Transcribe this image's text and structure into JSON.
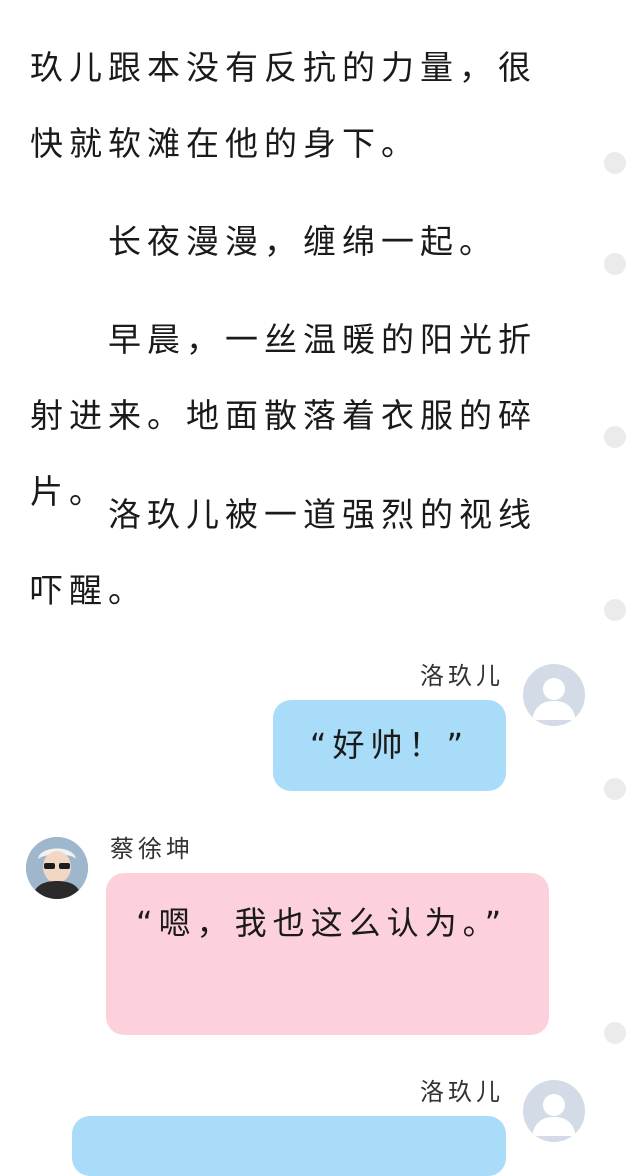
{
  "story": {
    "paragraphs": [
      "玖儿跟本没有反抗的力量，很快就软滩在他的身下。",
      "长夜漫漫，缠绵一起。",
      "早晨，一丝温暖的阳光折射进来。地面散落着衣服的碎片。",
      "洛玖儿被一道强烈的视线吓醒。"
    ]
  },
  "chat": [
    {
      "speaker": "洛玖儿",
      "side": "right",
      "text": "“好帅！”",
      "color": "#a8dcf8",
      "avatar": "default-avatar-icon"
    },
    {
      "speaker": "蔡徐坤",
      "side": "left",
      "text": "“嗯，我也这么认为。”",
      "color": "#fdd1dc",
      "avatar": "photo-avatar"
    },
    {
      "speaker": "洛玖儿",
      "side": "right",
      "text": "",
      "color": "#a8dcf8",
      "avatar": "default-avatar-icon"
    }
  ],
  "theme": {
    "bubble_blue": "#a8dcf8",
    "bubble_pink": "#fdd1dc",
    "rail_dot": "#ebebeb"
  }
}
